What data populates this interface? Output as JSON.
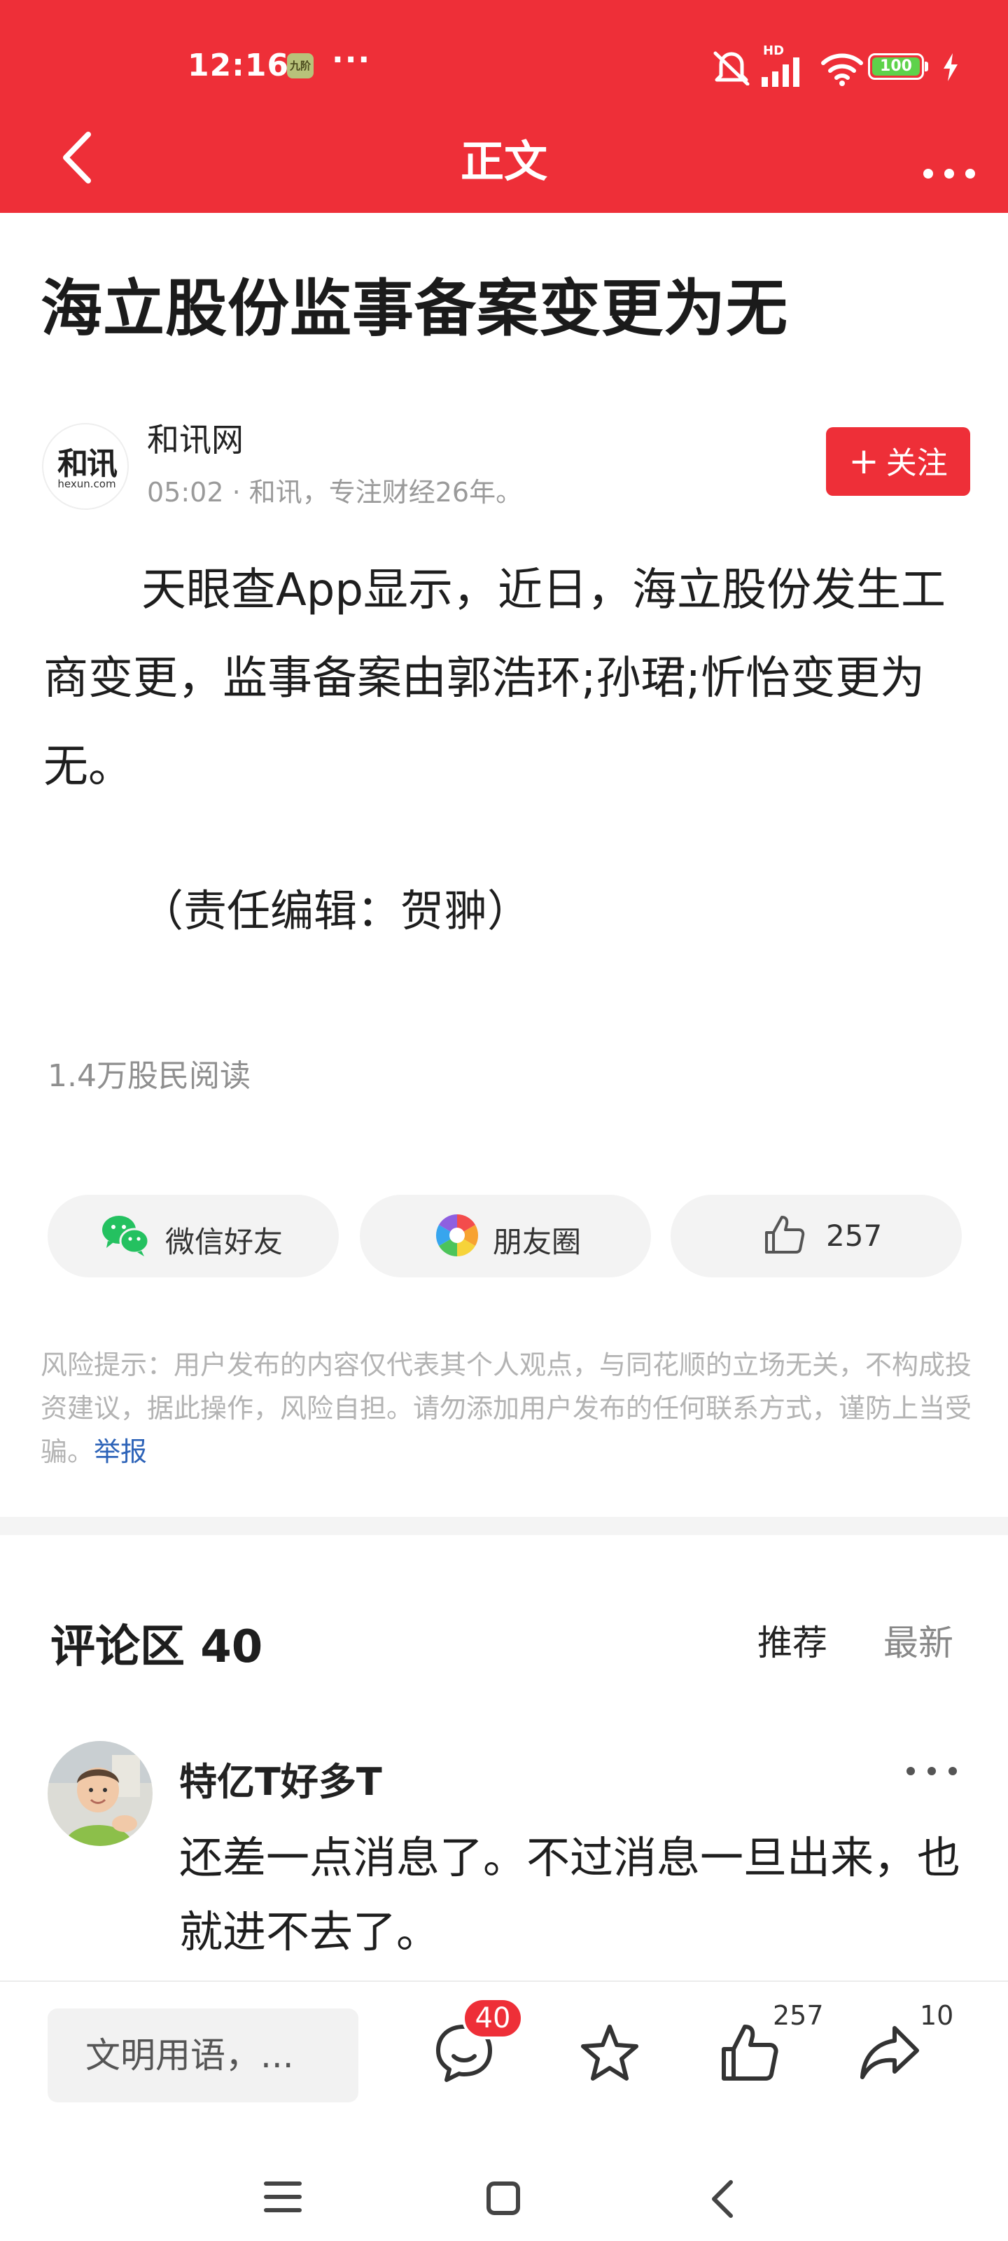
{
  "status_bar": {
    "time": "12:16",
    "app_badge": "九阶",
    "more_dots": "···",
    "hd_label": "HD",
    "battery": "100"
  },
  "nav": {
    "title": "正文"
  },
  "article": {
    "headline": "海立股份监事备案变更为无",
    "source": {
      "logo_text": "和讯",
      "logo_domain": "hexun.com",
      "name": "和讯网",
      "meta": "05:02 · 和讯，专注财经26年。"
    },
    "follow_label": "关注",
    "body": "天眼查App显示，近日，海立股份发生工商变更，监事备案由郭浩环;孙珺;忻怡变更为无。",
    "editor": "（责任编辑：贺翀）",
    "read_count": "1.4万股民阅读"
  },
  "share": {
    "wechat": "微信好友",
    "moments": "朋友圈",
    "likes": "257"
  },
  "risk": {
    "text": "风险提示：用户发布的内容仅代表其个人观点，与同花顺的立场无关，不构成投资建议，据此操作，风险自担。请勿添加用户发布的任何联系方式，谨防上当受骗。",
    "report": "举报"
  },
  "comments": {
    "title": "评论区 40",
    "sort_recommended": "推荐",
    "sort_newest": "最新",
    "items": [
      {
        "user": "特亿T好多T",
        "text": "还差一点消息了。不过消息一旦出来，也就进不去了。"
      }
    ]
  },
  "bottom_bar": {
    "input_placeholder": "文明用语，...",
    "comment_count": "40",
    "like_count": "257",
    "share_count": "10"
  },
  "colors": {
    "brand_red": "#ee2f38",
    "link_blue": "#2d63b8",
    "battery_green": "#5ed24a"
  }
}
